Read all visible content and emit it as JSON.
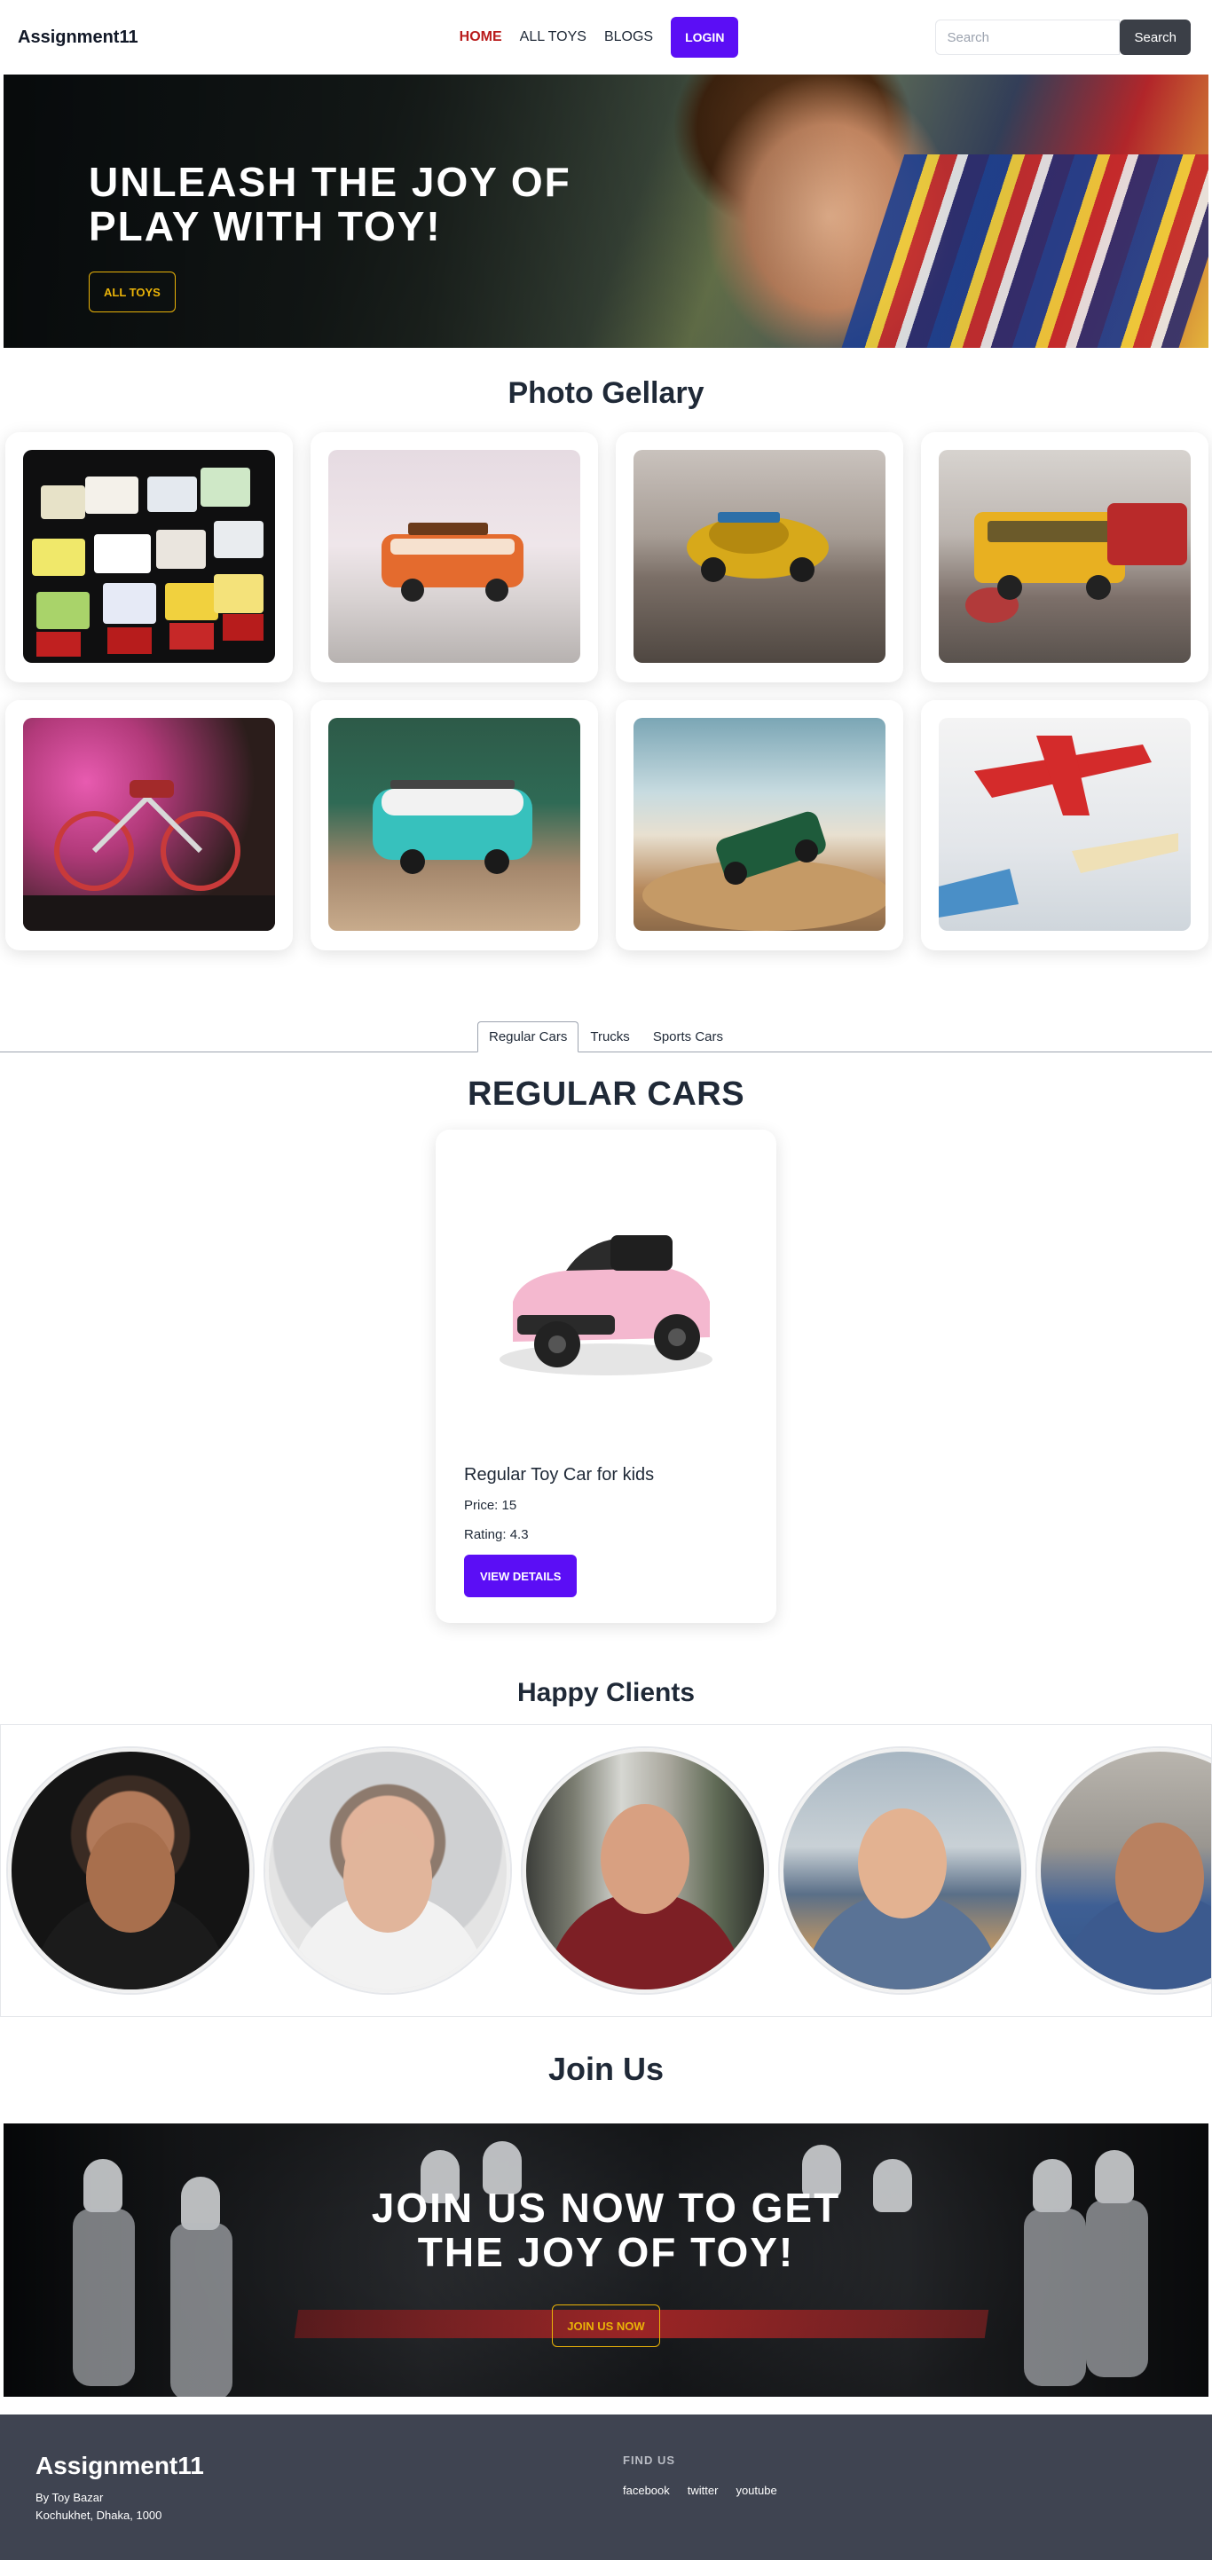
{
  "navbar": {
    "brand": "Assignment11",
    "links": [
      {
        "label": "HOME",
        "active": true
      },
      {
        "label": "ALL TOYS",
        "active": false
      },
      {
        "label": "BLOGS",
        "active": false
      }
    ],
    "login_label": "LOGIN",
    "search_placeholder": "Search",
    "search_button": "Search"
  },
  "hero": {
    "title": "UNLEASH THE JOY OF PLAY WITH TOY!",
    "button": "ALL TOYS"
  },
  "gallery": {
    "title": "Photo Gellary",
    "images": [
      {
        "icon": "toy-trucks-collection-image"
      },
      {
        "icon": "toy-orange-van-image"
      },
      {
        "icon": "toy-yellow-beetle-image"
      },
      {
        "icon": "toy-school-bus-image"
      },
      {
        "icon": "toy-motorcycle-image"
      },
      {
        "icon": "toy-camper-van-image"
      },
      {
        "icon": "toy-green-car-image"
      },
      {
        "icon": "toy-airplane-image"
      }
    ]
  },
  "tabs": {
    "items": [
      "Regular Cars",
      "Trucks",
      "Sports Cars"
    ],
    "active_index": 0,
    "heading": "REGULAR CARS"
  },
  "product": {
    "name": "Regular Toy Car for kids",
    "price": "Price: 15",
    "rating": "Rating: 4.3",
    "button": "VIEW DETAILS",
    "color": "#f4b8cf"
  },
  "clients": {
    "title": "Happy Clients",
    "count": 5
  },
  "join": {
    "title": "Join Us",
    "heading": "JOIN US NOW TO GET THE JOY OF TOY!",
    "button": "JOIN US NOW"
  },
  "footer": {
    "brand": "Assignment11",
    "line1": "By Toy Bazar",
    "line2": "Kochukhet, Dhaka, 1000",
    "heading": "FIND US",
    "links": [
      "facebook",
      "twitter",
      "youtube"
    ]
  },
  "colors": {
    "primary": "#5b0ef5",
    "accent": "#eab308",
    "active_nav": "#b91c1c",
    "footer_bg": "#3f4451"
  }
}
